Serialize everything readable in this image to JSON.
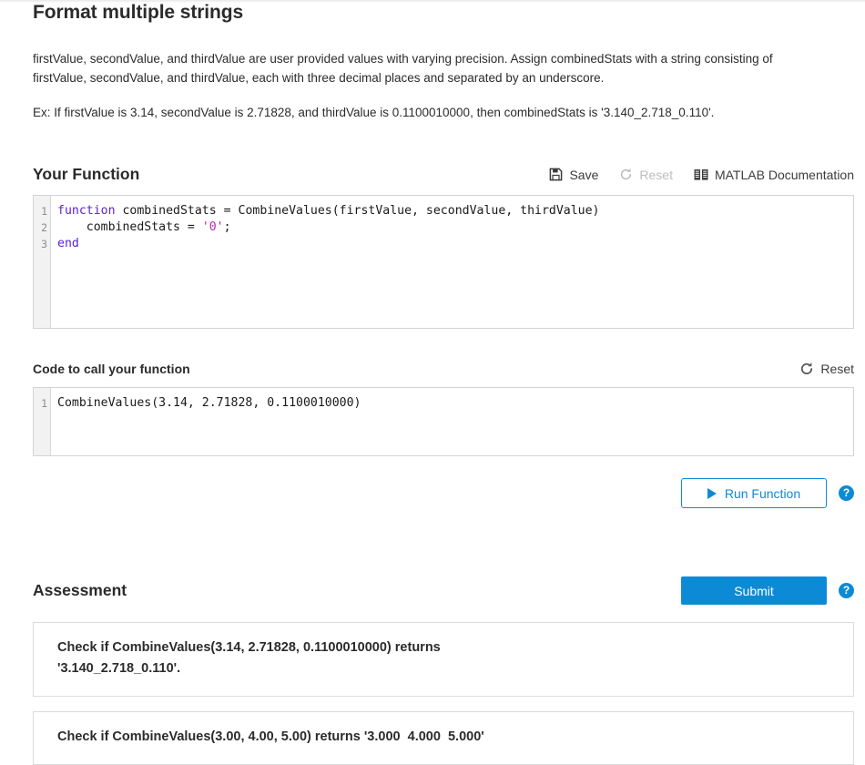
{
  "title": "Format multiple strings",
  "description": {
    "paragraph1": "firstValue, secondValue, and thirdValue are user provided values with varying precision. Assign combinedStats with a string consisting of firstValue, secondValue, and thirdValue, each with three decimal places and separated by an underscore.",
    "paragraph2": "Ex: If firstValue is 3.14, secondValue is 2.71828, and thirdValue is 0.1100010000, then combinedStats is '3.140_2.718_0.110'."
  },
  "function_section": {
    "heading": "Your Function",
    "actions": {
      "save_label": "Save",
      "reset_label": "Reset",
      "docs_label": "MATLAB Documentation"
    },
    "editor": {
      "line_numbers": [
        "1",
        "2",
        "3"
      ],
      "lines": [
        {
          "parts": [
            {
              "text": "function",
              "type": "keyword"
            },
            {
              "text": " combinedStats = CombineValues(firstValue, secondValue, thirdValue)",
              "type": "plain"
            }
          ]
        },
        {
          "parts": [
            {
              "text": "    combinedStats = ",
              "type": "plain"
            },
            {
              "text": "'0'",
              "type": "string"
            },
            {
              "text": ";",
              "type": "plain"
            }
          ]
        },
        {
          "parts": [
            {
              "text": "end",
              "type": "keyword"
            }
          ]
        }
      ]
    }
  },
  "call_section": {
    "label": "Code to call your function",
    "reset_label": "Reset",
    "editor": {
      "line_numbers": [
        "1"
      ],
      "lines": [
        {
          "parts": [
            {
              "text": "CombineValues(3.14, 2.71828, 0.1100010000)",
              "type": "plain"
            }
          ]
        }
      ]
    },
    "run_label": "Run Function",
    "help_label": "?"
  },
  "assessment": {
    "heading": "Assessment",
    "submit_label": "Submit",
    "help_label": "?",
    "tests": [
      "Check if CombineValues(3.14, 2.71828, 0.1100010000) returns\n'3.140_2.718_0.110'.",
      "Check if CombineValues(3.00, 4.00, 5.00) returns '3.000  4.000  5.000'"
    ]
  },
  "colors": {
    "accent": "#0d8ad6",
    "keyword": "#5b22d6",
    "string": "#b52ab5",
    "text": "#2b2b2b",
    "disabled": "#bdbdbd"
  }
}
